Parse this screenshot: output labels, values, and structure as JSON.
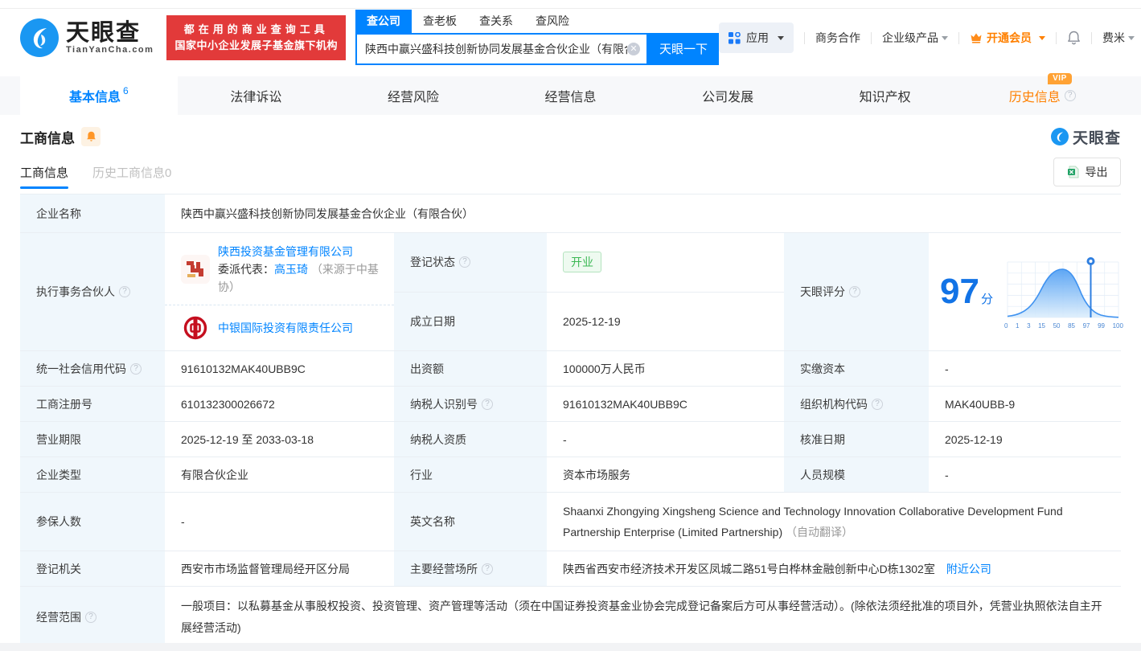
{
  "header": {
    "brand": "天眼查",
    "brand_domain": "TianYanCha.com",
    "banner_line1": "都在用的商业查询工具",
    "banner_line2": "国家中小企业发展子基金旗下机构",
    "search_tabs": {
      "company": "查公司",
      "boss": "查老板",
      "relation": "查关系",
      "risk": "查风险"
    },
    "search_value": "陕西中赢兴盛科技创新协同发展基金合伙企业（有限合",
    "search_button": "天眼一下",
    "nav": {
      "apps": "应用",
      "cooperation": "商务合作",
      "enterprise": "企业级产品",
      "vip": "开通会员",
      "user": "费米"
    }
  },
  "tabs": {
    "basic": "基本信息",
    "basic_count": "6",
    "legal": "法律诉讼",
    "risk": "经营风险",
    "operation": "经营信息",
    "development": "公司发展",
    "ip": "知识产权",
    "history": "历史信息",
    "history_vip": "VIP"
  },
  "section": {
    "title": "工商信息",
    "watermark": "天眼查"
  },
  "subtabs": {
    "current": "工商信息",
    "history": "历史工商信息0",
    "export": "导出"
  },
  "table": {
    "company_name_label": "企业名称",
    "company_name": "陕西中赢兴盛科技创新协同发展基金合伙企业（有限合伙）",
    "partner_label": "执行事务合伙人",
    "partner1_name": "陕西投资基金管理有限公司",
    "partner1_rep_label": "委派代表：",
    "partner1_rep": "高玉琦",
    "partner1_rep_note": "（来源于中基协）",
    "partner2_name": "中银国际投资有限责任公司",
    "reg_status_label": "登记状态",
    "reg_status": "开业",
    "establish_label": "成立日期",
    "establish_date": "2025-12-19",
    "score_label": "天眼评分",
    "score_value": "97",
    "score_unit": "分",
    "credit_code_label": "统一社会信用代码",
    "credit_code": "91610132MAK40UBB9C",
    "capital_label": "出资额",
    "capital": "100000万人民币",
    "paid_capital_label": "实缴资本",
    "paid_capital": "-",
    "reg_no_label": "工商注册号",
    "reg_no": "610132300026672",
    "taxpayer_id_label": "纳税人识别号",
    "taxpayer_id": "91610132MAK40UBB9C",
    "org_code_label": "组织机构代码",
    "org_code": "MAK40UBB-9",
    "term_label": "营业期限",
    "term": "2025-12-19 至 2033-03-18",
    "taxpayer_quality_label": "纳税人资质",
    "taxpayer_quality": "-",
    "approve_date_label": "核准日期",
    "approve_date": "2025-12-19",
    "company_type_label": "企业类型",
    "company_type": "有限合伙企业",
    "industry_label": "行业",
    "industry": "资本市场服务",
    "staff_size_label": "人员规模",
    "staff_size": "-",
    "insured_label": "参保人数",
    "insured": "-",
    "english_name_label": "英文名称",
    "english_name": "Shaanxi Zhongying Xingsheng Science and Technology Innovation Collaborative Development Fund Partnership Enterprise (Limited Partnership)",
    "english_name_note": "（自动翻译）",
    "authority_label": "登记机关",
    "authority": "西安市市场监督管理局经开区分局",
    "address_label": "主要经营场所",
    "address": "陕西省西安市经济技术开发区凤城二路51号白桦林金融创新中心D栋1302室",
    "nearby_link": "附近公司",
    "scope_label": "经营范围",
    "scope": "一般项目：以私募基金从事股权投资、投资管理、资产管理等活动（须在中国证券投资基金业协会完成登记备案后方可从事经营活动）。(除依法须经批准的项目外，凭营业执照依法自主开展经营活动)"
  },
  "chart_data": {
    "type": "area",
    "title": "天眼评分分布曲线",
    "score": 97,
    "x_ticks": [
      "0",
      "1",
      "3",
      "15",
      "50",
      "85",
      "97",
      "99",
      "100"
    ],
    "marker_at": "97",
    "description": "bell-shaped distribution curve with vertical marker pin at score 97",
    "grid": true
  },
  "colors": {
    "accent": "#0084ff",
    "banner_red": "#e23a3a",
    "vip_orange": "#ff8000",
    "badge_orange": "#ffa234",
    "status_green": "#3cb854",
    "label_bg": "#f0f7fc",
    "score_blue": "#1273e6"
  }
}
